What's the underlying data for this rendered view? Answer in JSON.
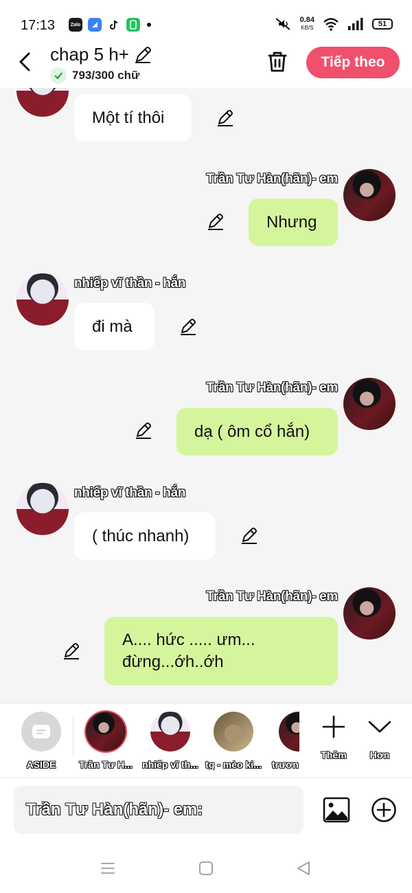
{
  "status_bar": {
    "time": "17:13",
    "apps": [
      {
        "name": "zalo-icon",
        "label": "Zalo",
        "color": "#1a1a1a"
      },
      {
        "name": "blue-app-icon",
        "label": "",
        "color": "#3b82f6"
      },
      {
        "name": "tiktok-icon",
        "label": "",
        "color": "#111111"
      },
      {
        "name": "green-app-icon",
        "label": "",
        "color": "#22c55e"
      }
    ],
    "speed_value": "0.84",
    "speed_unit": "KB/S",
    "battery": "51"
  },
  "header": {
    "title": "chap 5 h+",
    "word_count": "793/300 chữ",
    "next_label": "Tiếp theo",
    "accent_color": "#f0506b"
  },
  "messages": [
    {
      "side": "left",
      "sender": "",
      "text": "Một tí thôi",
      "avatar": "boy"
    },
    {
      "side": "right",
      "sender": "Trần Tư Hàn(hãn)- em",
      "text": "Nhưng",
      "avatar": "dark"
    },
    {
      "side": "left",
      "sender": "nhiếp vĩ thần - hắn",
      "text": "đi mà",
      "avatar": "boy"
    },
    {
      "side": "right",
      "sender": "Trần Tư Hàn(hãn)- em",
      "text": "dạ ( ôm cổ hắn)",
      "avatar": "dark"
    },
    {
      "side": "left",
      "sender": "nhiếp vĩ thần - hắn",
      "text": "( thúc nhanh)",
      "avatar": "boy"
    },
    {
      "side": "right",
      "sender": "Trần Tư Hàn(hãn)- em",
      "text_line1": "A.... hức ..... ưm...",
      "text_line2": "đừng...ớh..ớh",
      "avatar": "dark"
    }
  ],
  "characters": {
    "aside_label": "ASIDE",
    "items": [
      {
        "label": "Trần Tư H...",
        "avatar": "dark",
        "selected": true
      },
      {
        "label": "nhiếp vĩ th...",
        "avatar": "boy",
        "selected": false
      },
      {
        "label": "tg - mèo ki...",
        "avatar": "cat",
        "selected": false
      },
      {
        "label": "trươn",
        "avatar": "dark",
        "selected": false
      }
    ],
    "more_label": "Thêm",
    "less_label": "Hơn"
  },
  "input": {
    "current_speaker": "Trần Tư Hàn(hãn)- em:"
  }
}
